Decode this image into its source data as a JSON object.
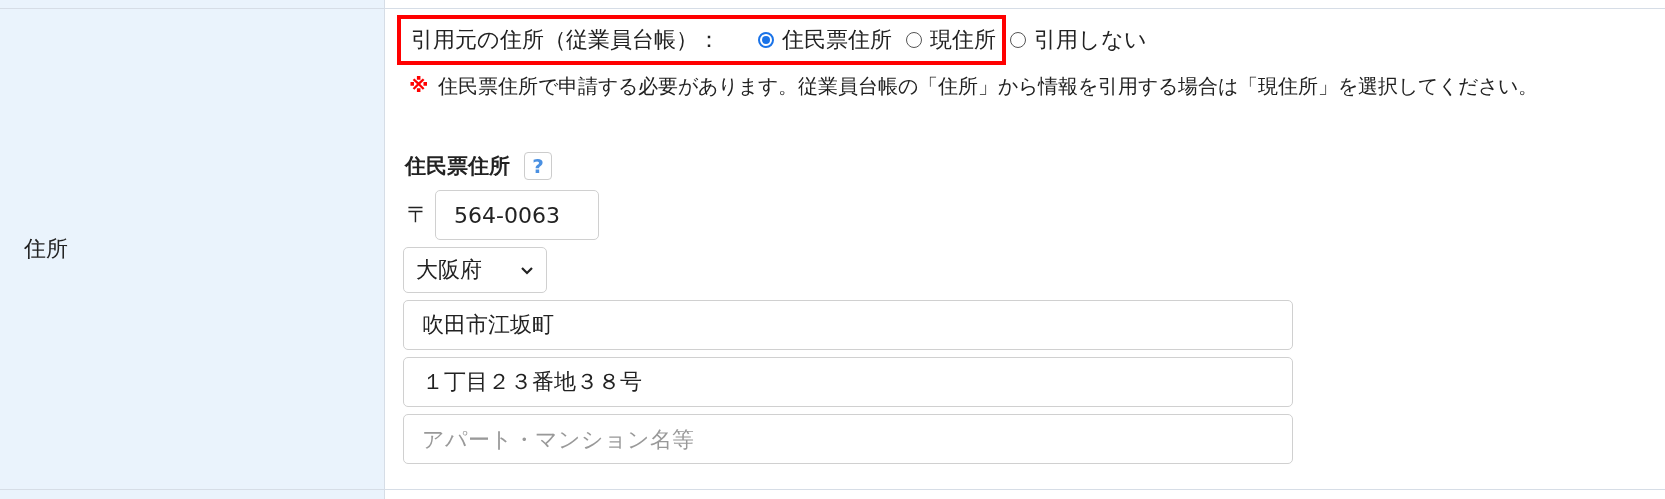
{
  "row": {
    "label": "住所",
    "source_selector": {
      "label": "引用元の住所（従業員台帳）：",
      "highlighted": true,
      "options": [
        {
          "label": "住民票住所",
          "selected": true
        },
        {
          "label": "現住所",
          "selected": false
        }
      ],
      "more_options": [
        {
          "label": "引用しない",
          "selected": false
        }
      ]
    },
    "note": {
      "mark": "※",
      "text": "住民票住所で申請する必要があります。従業員台帳の「住所」から情報を引用する場合は「現住所」を選択してください。"
    },
    "section_title": "住民票住所",
    "help_icon": "?",
    "postal": {
      "mark": "〒",
      "value": "564-0063"
    },
    "prefecture": {
      "value": "大阪府"
    },
    "address_fields": [
      {
        "value": "吹田市江坂町"
      },
      {
        "value": "１丁目２３番地３８号"
      },
      {
        "placeholder": "アパート・マンション名等"
      }
    ]
  }
}
